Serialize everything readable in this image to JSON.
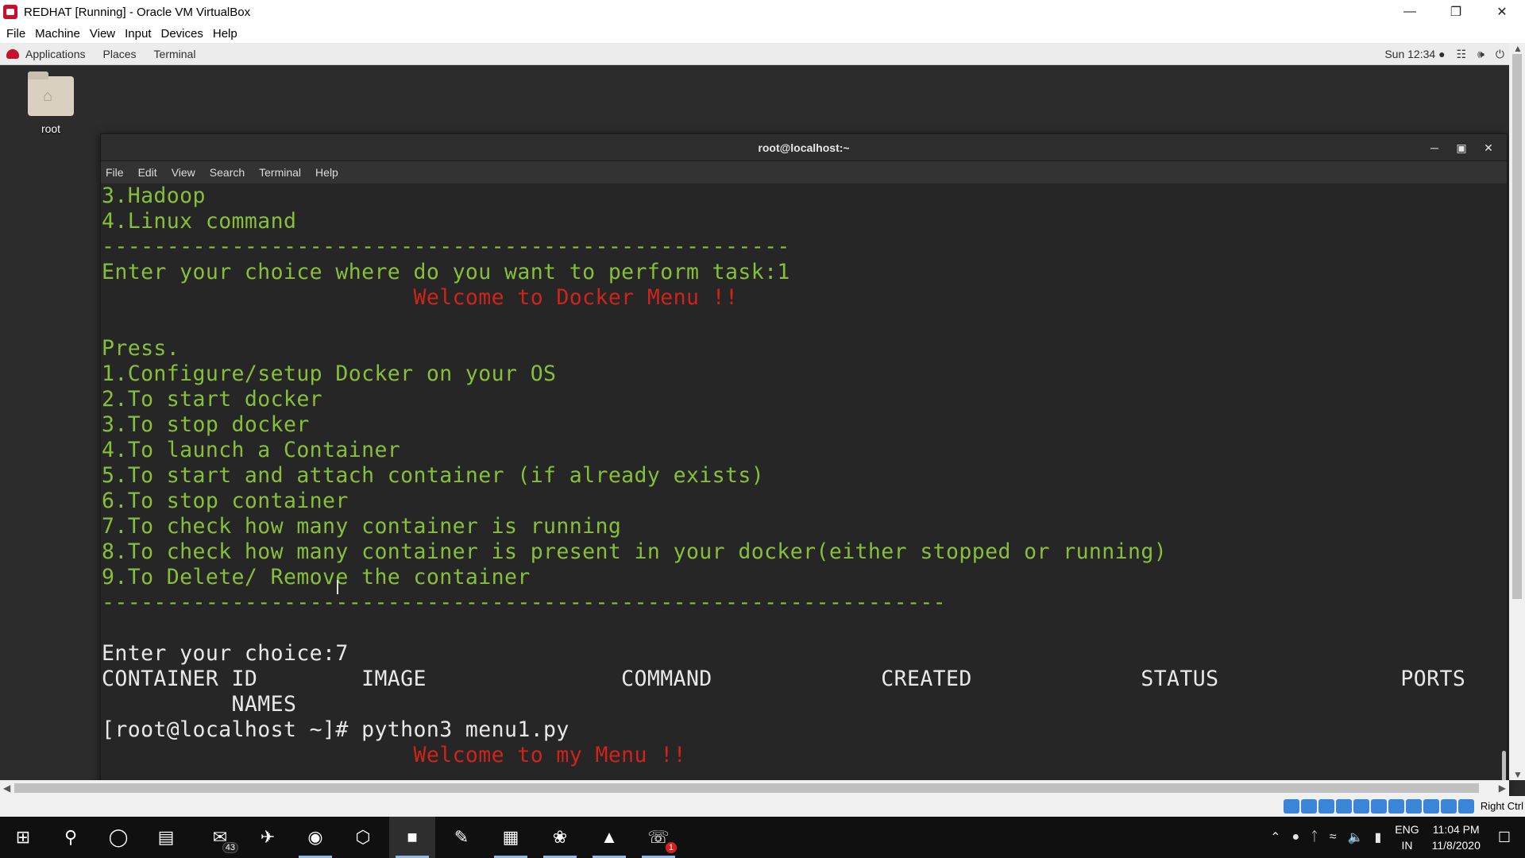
{
  "vbox": {
    "title": "REDHAT [Running] - Oracle VM VirtualBox",
    "menu": [
      "File",
      "Machine",
      "View",
      "Input",
      "Devices",
      "Help"
    ],
    "host_key": "Right Ctrl"
  },
  "gnome": {
    "applications": "Applications",
    "places": "Places",
    "terminal": "Terminal",
    "clock": "Sun 12:34 ●"
  },
  "desktop": {
    "icon_label": "root"
  },
  "terminal": {
    "title": "root@localhost:~",
    "menu": [
      "File",
      "Edit",
      "View",
      "Search",
      "Terminal",
      "Help"
    ],
    "lines": [
      {
        "text": "3.Hadoop",
        "color": "green"
      },
      {
        "text": "4.Linux command",
        "color": "green"
      },
      {
        "text": "-----------------------------------------------------",
        "color": "green"
      },
      {
        "text": "Enter your choice where do you want to perform task:1",
        "color": "green"
      },
      {
        "text": "                        Welcome to Docker Menu !!",
        "color": "red"
      },
      {
        "text": "",
        "color": "green"
      },
      {
        "text": "Press.",
        "color": "green"
      },
      {
        "text": "1.Configure/setup Docker on your OS",
        "color": "green"
      },
      {
        "text": "2.To start docker",
        "color": "green"
      },
      {
        "text": "3.To stop docker",
        "color": "green"
      },
      {
        "text": "4.To launch a Container",
        "color": "green"
      },
      {
        "text": "5.To start and attach container (if already exists)",
        "color": "green"
      },
      {
        "text": "6.To stop container",
        "color": "green"
      },
      {
        "text": "7.To check how many container is running",
        "color": "green"
      },
      {
        "text": "8.To check how many container is present in your docker(either stopped or running)",
        "color": "green"
      },
      {
        "text": "9.To Delete/ Remove the container",
        "color": "green"
      },
      {
        "text": "-----------------------------------------------------------------",
        "color": "green"
      },
      {
        "text": "",
        "color": "white"
      },
      {
        "text": "Enter your choice:7",
        "color": "white"
      },
      {
        "text": "CONTAINER ID        IMAGE               COMMAND             CREATED             STATUS              PORTS",
        "color": "white"
      },
      {
        "text": "          NAMES",
        "color": "white"
      },
      {
        "text": "[root@localhost ~]# python3 menu1.py",
        "color": "white"
      },
      {
        "text": "                        Welcome to my Menu !!",
        "color": "red"
      },
      {
        "text": "-----------------------------------------------------",
        "color": "green"
      }
    ]
  },
  "taskbar": {
    "mail_badge": "43",
    "app_badge": "1",
    "lang_top": "ENG",
    "lang_bottom": "IN",
    "time": "11:04 PM",
    "date": "11/8/2020"
  }
}
